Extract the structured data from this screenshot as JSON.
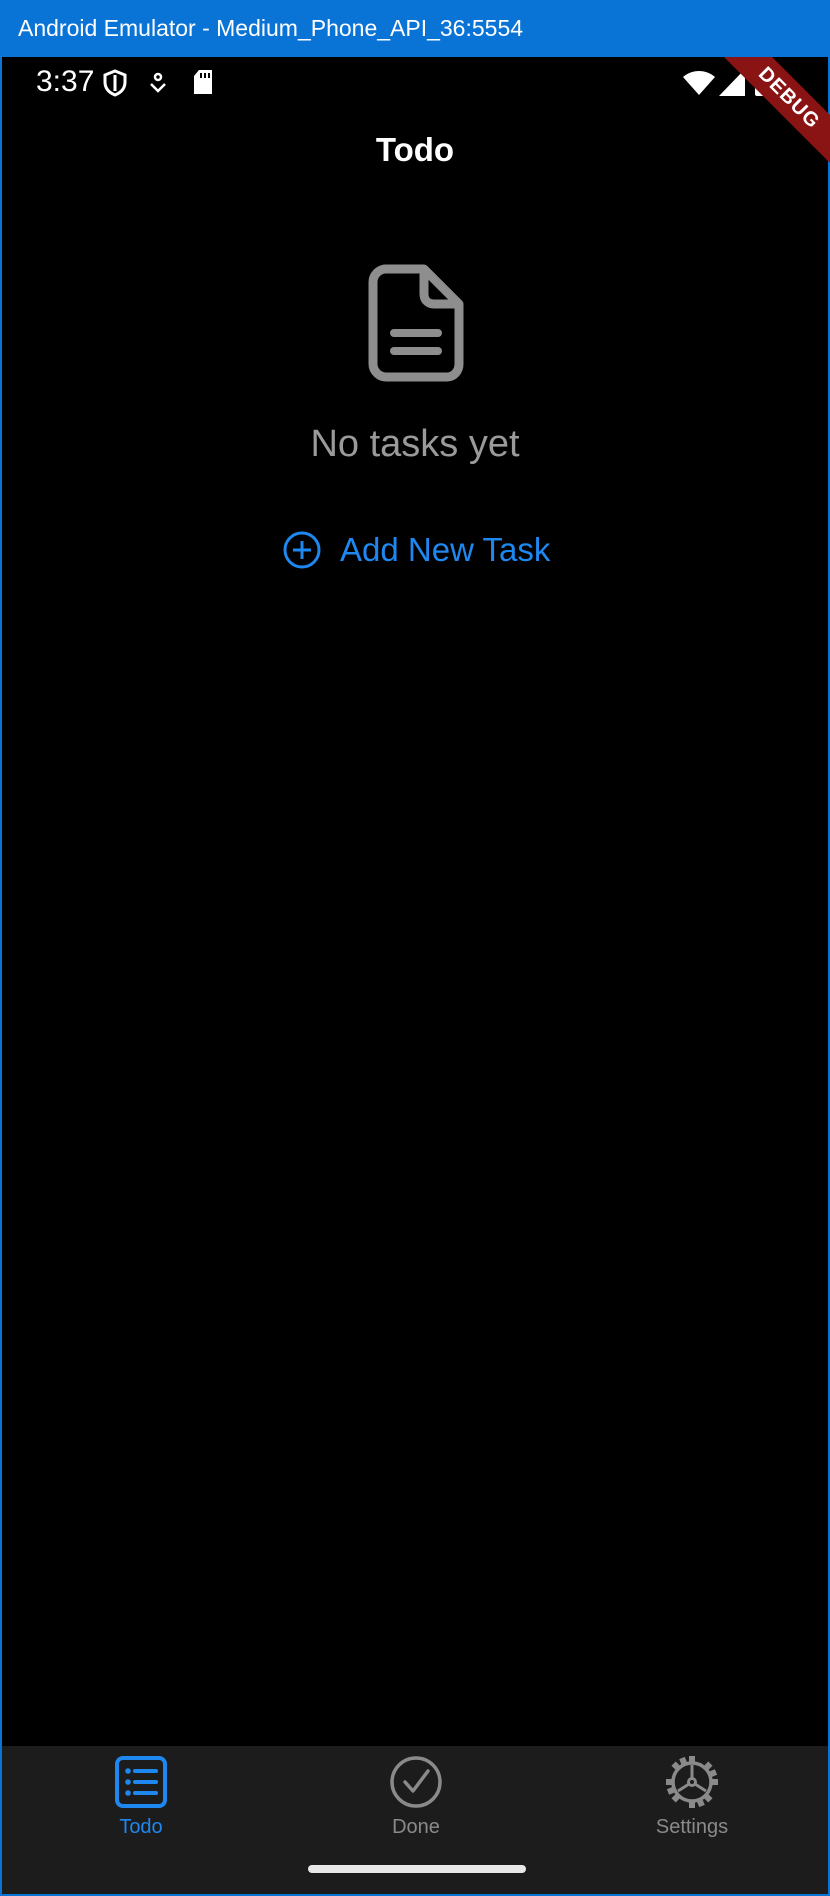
{
  "window": {
    "title": "Android Emulator - Medium_Phone_API_36:5554"
  },
  "status_bar": {
    "time": "3:37",
    "left_icons": [
      "shield-icon",
      "notification-icon",
      "sd-card-icon"
    ],
    "right_icons": [
      "wifi-icon",
      "cell-signal-icon",
      "battery-icon"
    ]
  },
  "debug_banner": {
    "label": "DEBUG"
  },
  "app_bar": {
    "title": "Todo"
  },
  "empty_state": {
    "icon": "document-icon",
    "message": "No tasks yet",
    "add_button_label": "Add New Task",
    "add_button_icon": "add-circle-icon"
  },
  "bottom_nav": {
    "items": [
      {
        "label": "Todo",
        "icon": "list-icon",
        "selected": true
      },
      {
        "label": "Done",
        "icon": "check-circle-icon",
        "selected": false
      },
      {
        "label": "Settings",
        "icon": "gear-icon",
        "selected": false
      }
    ]
  },
  "colors": {
    "accent": "#1e88f0",
    "titlebar": "#0a74d6",
    "background": "#000000",
    "nav_background": "#1c1c1c",
    "muted": "#9a9a9a",
    "debug_ribbon": "#8a1414"
  }
}
